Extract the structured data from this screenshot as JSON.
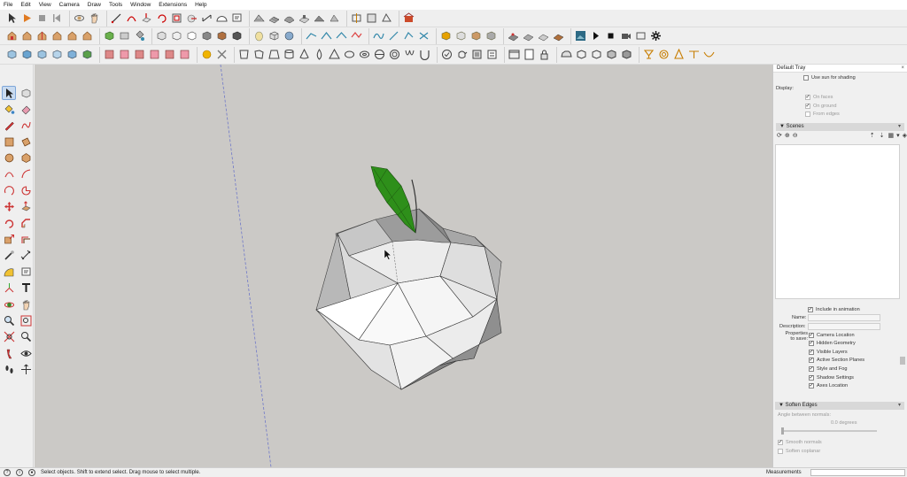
{
  "menu": [
    "File",
    "Edit",
    "View",
    "Camera",
    "Draw",
    "Tools",
    "Window",
    "Extensions",
    "Help"
  ],
  "toolbar_icons": [
    "select-icon",
    "animation-play-icon",
    "stop-icon",
    "rewind-icon",
    "orbit-icon",
    "pan-icon",
    "zoom-icon",
    "pencil-icon",
    "arc-icon",
    "shape-icon"
  ],
  "tray": {
    "title": "Default Tray",
    "close": "×",
    "shadow": {
      "use_sun_label": "Use sun for shading",
      "display_label": "Display:",
      "on_faces": "On faces",
      "on_ground": "On ground",
      "from_edges": "From edges"
    },
    "scenes": {
      "header": "Scenes",
      "include_animation": "Include in animation",
      "name_label": "Name:",
      "description_label": "Description:",
      "properties_label_1": "Properties",
      "properties_label_2": "to save:",
      "properties": [
        "Camera Location",
        "Hidden Geometry",
        "Visible Layers",
        "Active Section Planes",
        "Style and Fog",
        "Shadow Settings",
        "Axes Location"
      ]
    },
    "soften": {
      "header": "Soften Edges",
      "angle_label": "Angle between normals:",
      "angle_value": "0.0  degrees",
      "smooth_normals": "Smooth normals",
      "soften_coplanar": "Soften coplanar"
    }
  },
  "status": {
    "message": "Select objects. Shift to extend select. Drag mouse to select multiple.",
    "measurements_label": "Measurements"
  },
  "colors": {
    "viewport_bg": "#cbc9c6",
    "leaf_green": "#2e8f1a"
  }
}
